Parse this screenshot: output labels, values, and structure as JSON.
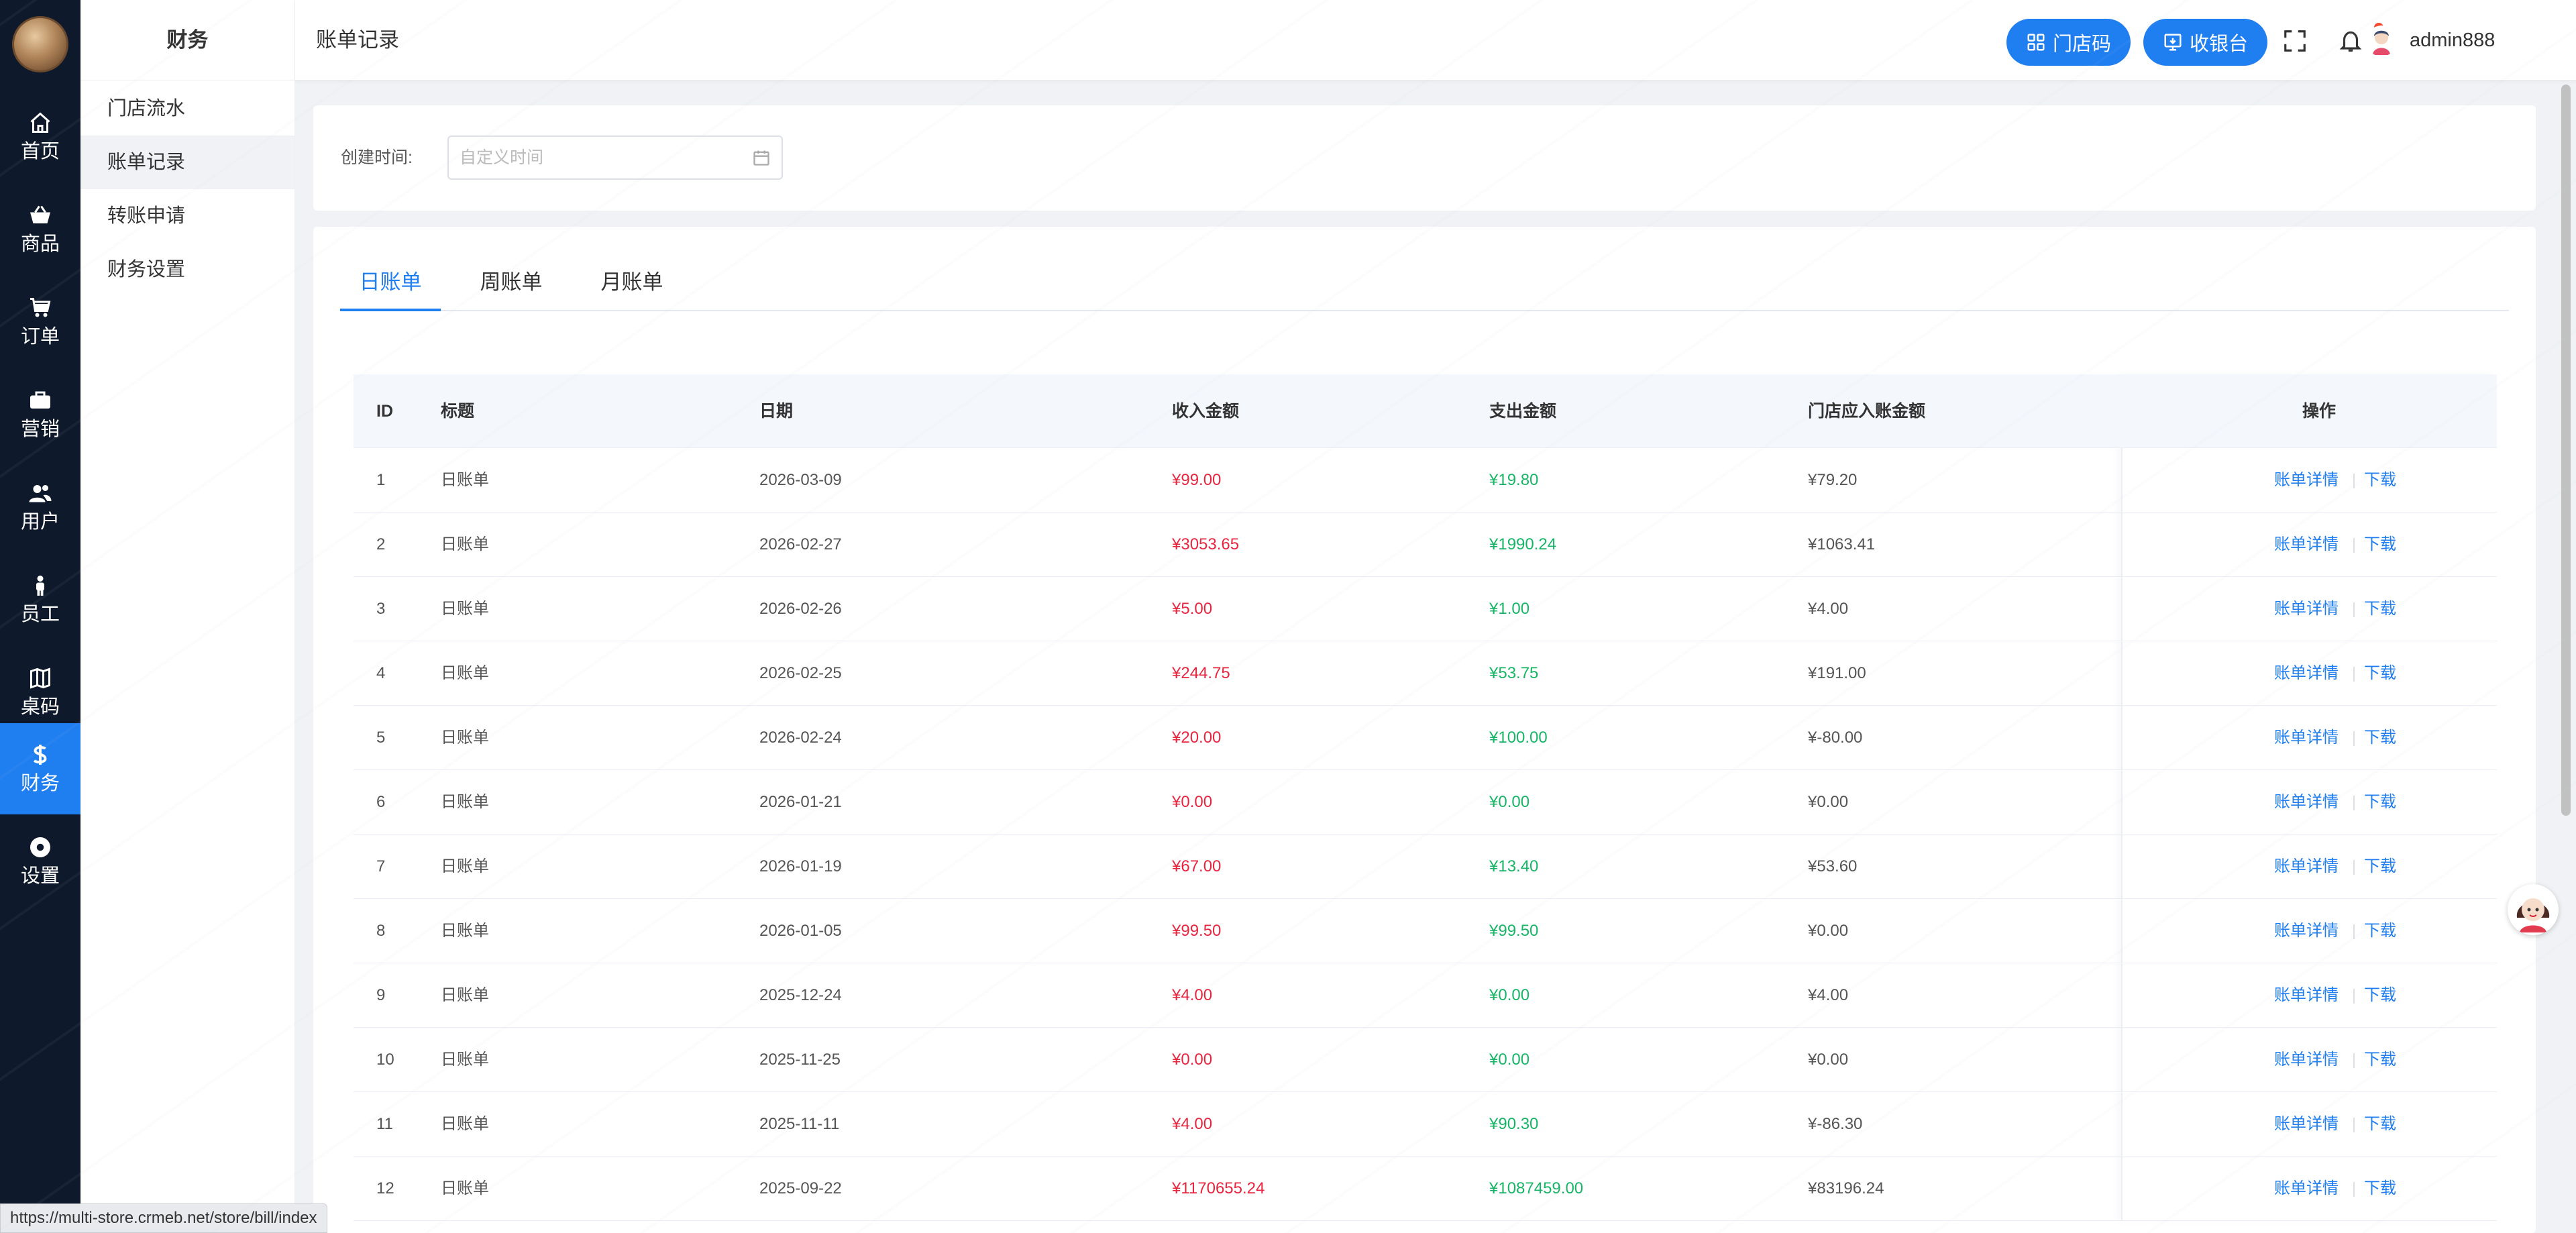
{
  "rail": {
    "items": [
      {
        "label": "首页",
        "icon": "home-icon"
      },
      {
        "label": "商品",
        "icon": "basket-icon"
      },
      {
        "label": "订单",
        "icon": "cart-icon"
      },
      {
        "label": "营销",
        "icon": "briefcase-icon"
      },
      {
        "label": "用户",
        "icon": "users-icon"
      },
      {
        "label": "员工",
        "icon": "person-icon"
      },
      {
        "label": "桌码",
        "icon": "map-icon"
      },
      {
        "label": "财务",
        "icon": "dollar-icon"
      },
      {
        "label": "设置",
        "icon": "settings-icon"
      }
    ],
    "active": "财务"
  },
  "submenu": {
    "title": "财务",
    "items": [
      {
        "label": "门店流水"
      },
      {
        "label": "账单记录"
      },
      {
        "label": "转账申请"
      },
      {
        "label": "财务设置"
      }
    ],
    "active": "账单记录"
  },
  "header": {
    "breadcrumb": "账单记录",
    "store_code_label": "门店码",
    "cashier_label": "收银台",
    "username": "admin888"
  },
  "filter": {
    "label": "创建时间:",
    "date_placeholder": "自定义时间"
  },
  "tabs": [
    {
      "label": "日账单"
    },
    {
      "label": "周账单"
    },
    {
      "label": "月账单"
    }
  ],
  "active_tab": "日账单",
  "table": {
    "columns": [
      "ID",
      "标题",
      "日期",
      "收入金额",
      "支出金额",
      "门店应入账金额",
      "操作"
    ],
    "rows": [
      {
        "id": "1",
        "title": "日账单",
        "date": "2026-03-09",
        "income": "¥99.00",
        "expense": "¥19.80",
        "net": "¥79.20"
      },
      {
        "id": "2",
        "title": "日账单",
        "date": "2026-02-27",
        "income": "¥3053.65",
        "expense": "¥1990.24",
        "net": "¥1063.41"
      },
      {
        "id": "3",
        "title": "日账单",
        "date": "2026-02-26",
        "income": "¥5.00",
        "expense": "¥1.00",
        "net": "¥4.00"
      },
      {
        "id": "4",
        "title": "日账单",
        "date": "2026-02-25",
        "income": "¥244.75",
        "expense": "¥53.75",
        "net": "¥191.00"
      },
      {
        "id": "5",
        "title": "日账单",
        "date": "2026-02-24",
        "income": "¥20.00",
        "expense": "¥100.00",
        "net": "¥-80.00"
      },
      {
        "id": "6",
        "title": "日账单",
        "date": "2026-01-21",
        "income": "¥0.00",
        "expense": "¥0.00",
        "net": "¥0.00"
      },
      {
        "id": "7",
        "title": "日账单",
        "date": "2026-01-19",
        "income": "¥67.00",
        "expense": "¥13.40",
        "net": "¥53.60"
      },
      {
        "id": "8",
        "title": "日账单",
        "date": "2026-01-05",
        "income": "¥99.50",
        "expense": "¥99.50",
        "net": "¥0.00"
      },
      {
        "id": "9",
        "title": "日账单",
        "date": "2025-12-24",
        "income": "¥4.00",
        "expense": "¥0.00",
        "net": "¥4.00"
      },
      {
        "id": "10",
        "title": "日账单",
        "date": "2025-11-25",
        "income": "¥0.00",
        "expense": "¥0.00",
        "net": "¥0.00"
      },
      {
        "id": "11",
        "title": "日账单",
        "date": "2025-11-11",
        "income": "¥4.00",
        "expense": "¥90.30",
        "net": "¥-86.30"
      },
      {
        "id": "12",
        "title": "日账单",
        "date": "2025-09-22",
        "income": "¥1170655.24",
        "expense": "¥1087459.00",
        "net": "¥83196.24"
      }
    ],
    "detail_label": "账单详情",
    "download_label": "下载"
  },
  "statusbar": {
    "url": "https://multi-store.crmeb.net/store/bill/index"
  },
  "colors": {
    "primary": "#1f7ef0",
    "income": "#e8253f",
    "expense": "#18b566",
    "rail_bg": "#0e1a2b"
  }
}
